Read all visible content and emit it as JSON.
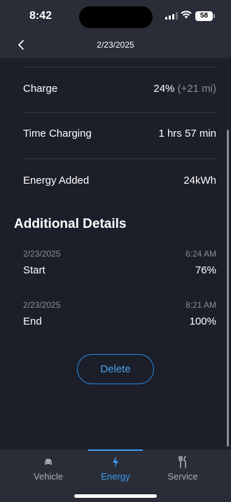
{
  "status_bar": {
    "time": "8:42",
    "battery": "58",
    "icons": [
      "signal-icon",
      "wifi-icon",
      "battery-icon"
    ]
  },
  "nav": {
    "title": "2/23/2025",
    "back_icon": "chevron-left-icon"
  },
  "summary": [
    {
      "label": "Charge",
      "value": "24%",
      "extra": "(+21 mi)"
    },
    {
      "label": "Time Charging",
      "value": "1 hrs 57 min",
      "extra": ""
    },
    {
      "label": "Energy Added",
      "value": "24kWh",
      "extra": ""
    }
  ],
  "additional": {
    "title": "Additional Details",
    "entries": [
      {
        "date": "2/23/2025",
        "time": "6:24 AM",
        "label": "Start",
        "value": "76%"
      },
      {
        "date": "2/23/2025",
        "time": "8:21 AM",
        "label": "End",
        "value": "100%"
      }
    ]
  },
  "actions": {
    "delete_label": "Delete"
  },
  "tabs": [
    {
      "label": "Vehicle",
      "icon": "car-icon",
      "active": false
    },
    {
      "label": "Energy",
      "icon": "lightning-icon",
      "active": true
    },
    {
      "label": "Service",
      "icon": "tools-icon",
      "active": false
    }
  ],
  "colors": {
    "background": "#1c1e29",
    "bar": "#2a2c38",
    "accent": "#3d9cf0",
    "muted": "#8b8e9a"
  }
}
